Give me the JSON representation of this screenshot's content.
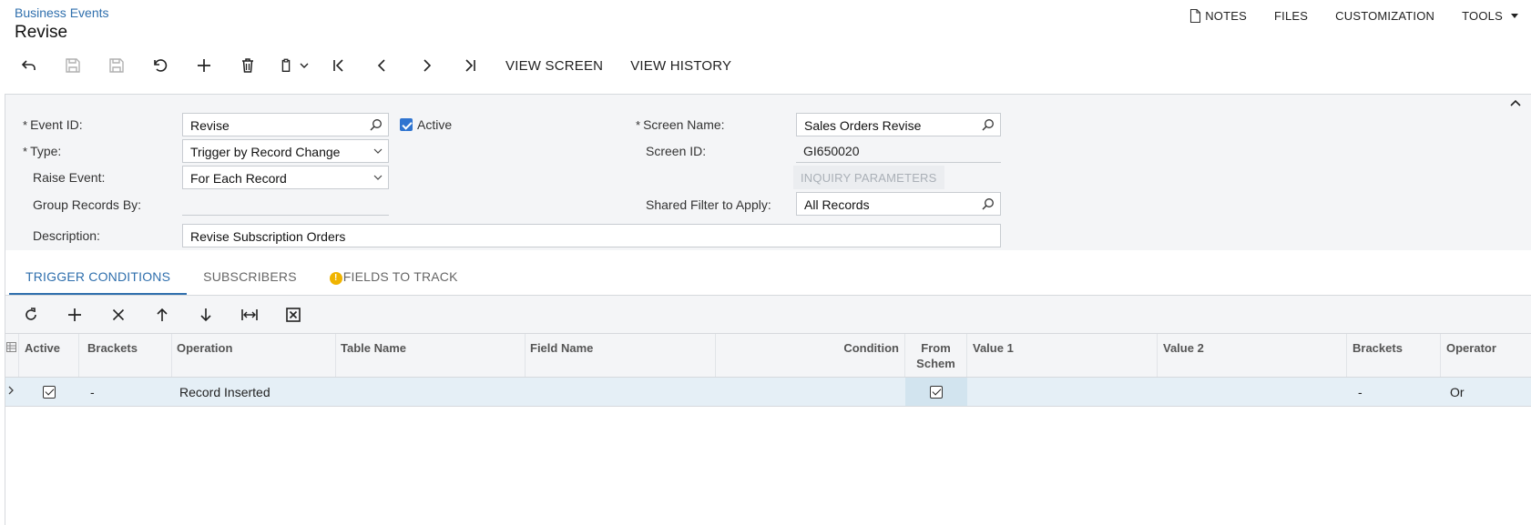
{
  "header": {
    "breadcrumb": "Business Events",
    "title": "Revise",
    "links": {
      "notes": "NOTES",
      "files": "FILES",
      "customization": "CUSTOMIZATION",
      "tools": "TOOLS"
    }
  },
  "toolbar": {
    "view_screen": "VIEW SCREEN",
    "view_history": "VIEW HISTORY"
  },
  "form": {
    "event_id_label": "Event ID:",
    "event_id_value": "Revise",
    "active_label": "Active",
    "type_label": "Type:",
    "type_value": "Trigger by Record Change",
    "raise_event_label": "Raise Event:",
    "raise_event_value": "For Each Record",
    "group_records_label": "Group Records By:",
    "description_label": "Description:",
    "description_value": "Revise Subscription Orders",
    "screen_name_label": "Screen Name:",
    "screen_name_value": "Sales Orders Revise",
    "screen_id_label": "Screen ID:",
    "screen_id_value": "GI650020",
    "inquiry_button": "INQUIRY PARAMETERS",
    "shared_filter_label": "Shared Filter to Apply:",
    "shared_filter_value": "All Records",
    "required_mark": "*"
  },
  "tabs": [
    {
      "label": "TRIGGER CONDITIONS"
    },
    {
      "label": "SUBSCRIBERS"
    },
    {
      "label": "FIELDS TO TRACK"
    }
  ],
  "grid": {
    "columns": {
      "active": "Active",
      "brackets_open": "Brackets",
      "operation": "Operation",
      "table_name": "Table Name",
      "field_name": "Field Name",
      "condition": "Condition",
      "from_schema_1": "From",
      "from_schema_2": "Schem",
      "value1": "Value 1",
      "value2": "Value 2",
      "brackets_close": "Brackets",
      "operator": "Operator"
    },
    "rows": [
      {
        "brackets_open": "-",
        "operation": "Record Inserted",
        "brackets_close": "-",
        "operator": "Or"
      }
    ]
  },
  "icons": {
    "colors": {
      "accent": "#2f6fad",
      "checkbox": "#2f74d0",
      "warning": "#f0b400",
      "selected_row": "#e5eff6"
    }
  }
}
